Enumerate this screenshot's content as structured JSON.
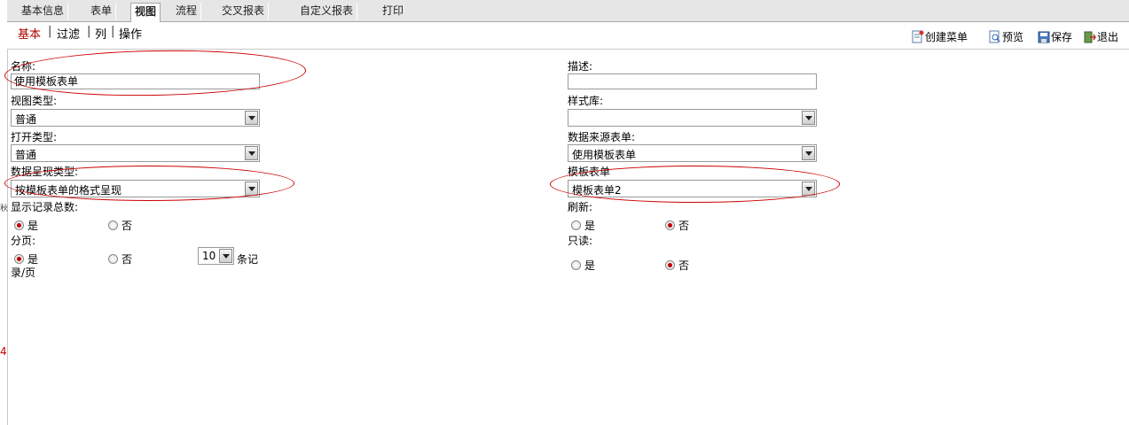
{
  "tabs": [
    "基本信息",
    "表单",
    "视图",
    "流程",
    "交叉报表",
    "自定义报表",
    "打印"
  ],
  "subtabs": [
    "基本",
    "过滤",
    "列",
    "操作"
  ],
  "toolbar": {
    "create_menu": "创建菜单",
    "preview": "预览",
    "save": "保存",
    "exit": "退出"
  },
  "form": {
    "name_label": "名称:",
    "name_value": "使用模板表单",
    "desc_label": "描述:",
    "desc_value": "",
    "view_type_label": "视图类型:",
    "view_type_value": "普通",
    "style_lib_label": "样式库:",
    "style_lib_value": "",
    "open_type_label": "打开类型:",
    "open_type_value": "普通",
    "data_source_label": "数据来源表单:",
    "data_source_value": "使用模板表单",
    "display_type_label": "数据呈现类型:",
    "display_type_value": "按模板表单的格式呈现",
    "template_label": "模板表单",
    "template_value": "模板表单2",
    "show_total_label": "显示记录总数:",
    "refresh_label": "刷新:",
    "paging_label": "分页:",
    "readonly_label": "只读:",
    "yes": "是",
    "no": "否",
    "page_size_value": "10",
    "page_size_suffix": "条记",
    "page_size_suffix2": "录/页"
  },
  "side_marks": [
    "秋",
    "4"
  ],
  "colors": {
    "annotation": "#cc0000",
    "active_subtab": "#b00000",
    "radio_selected": "#c00000"
  }
}
